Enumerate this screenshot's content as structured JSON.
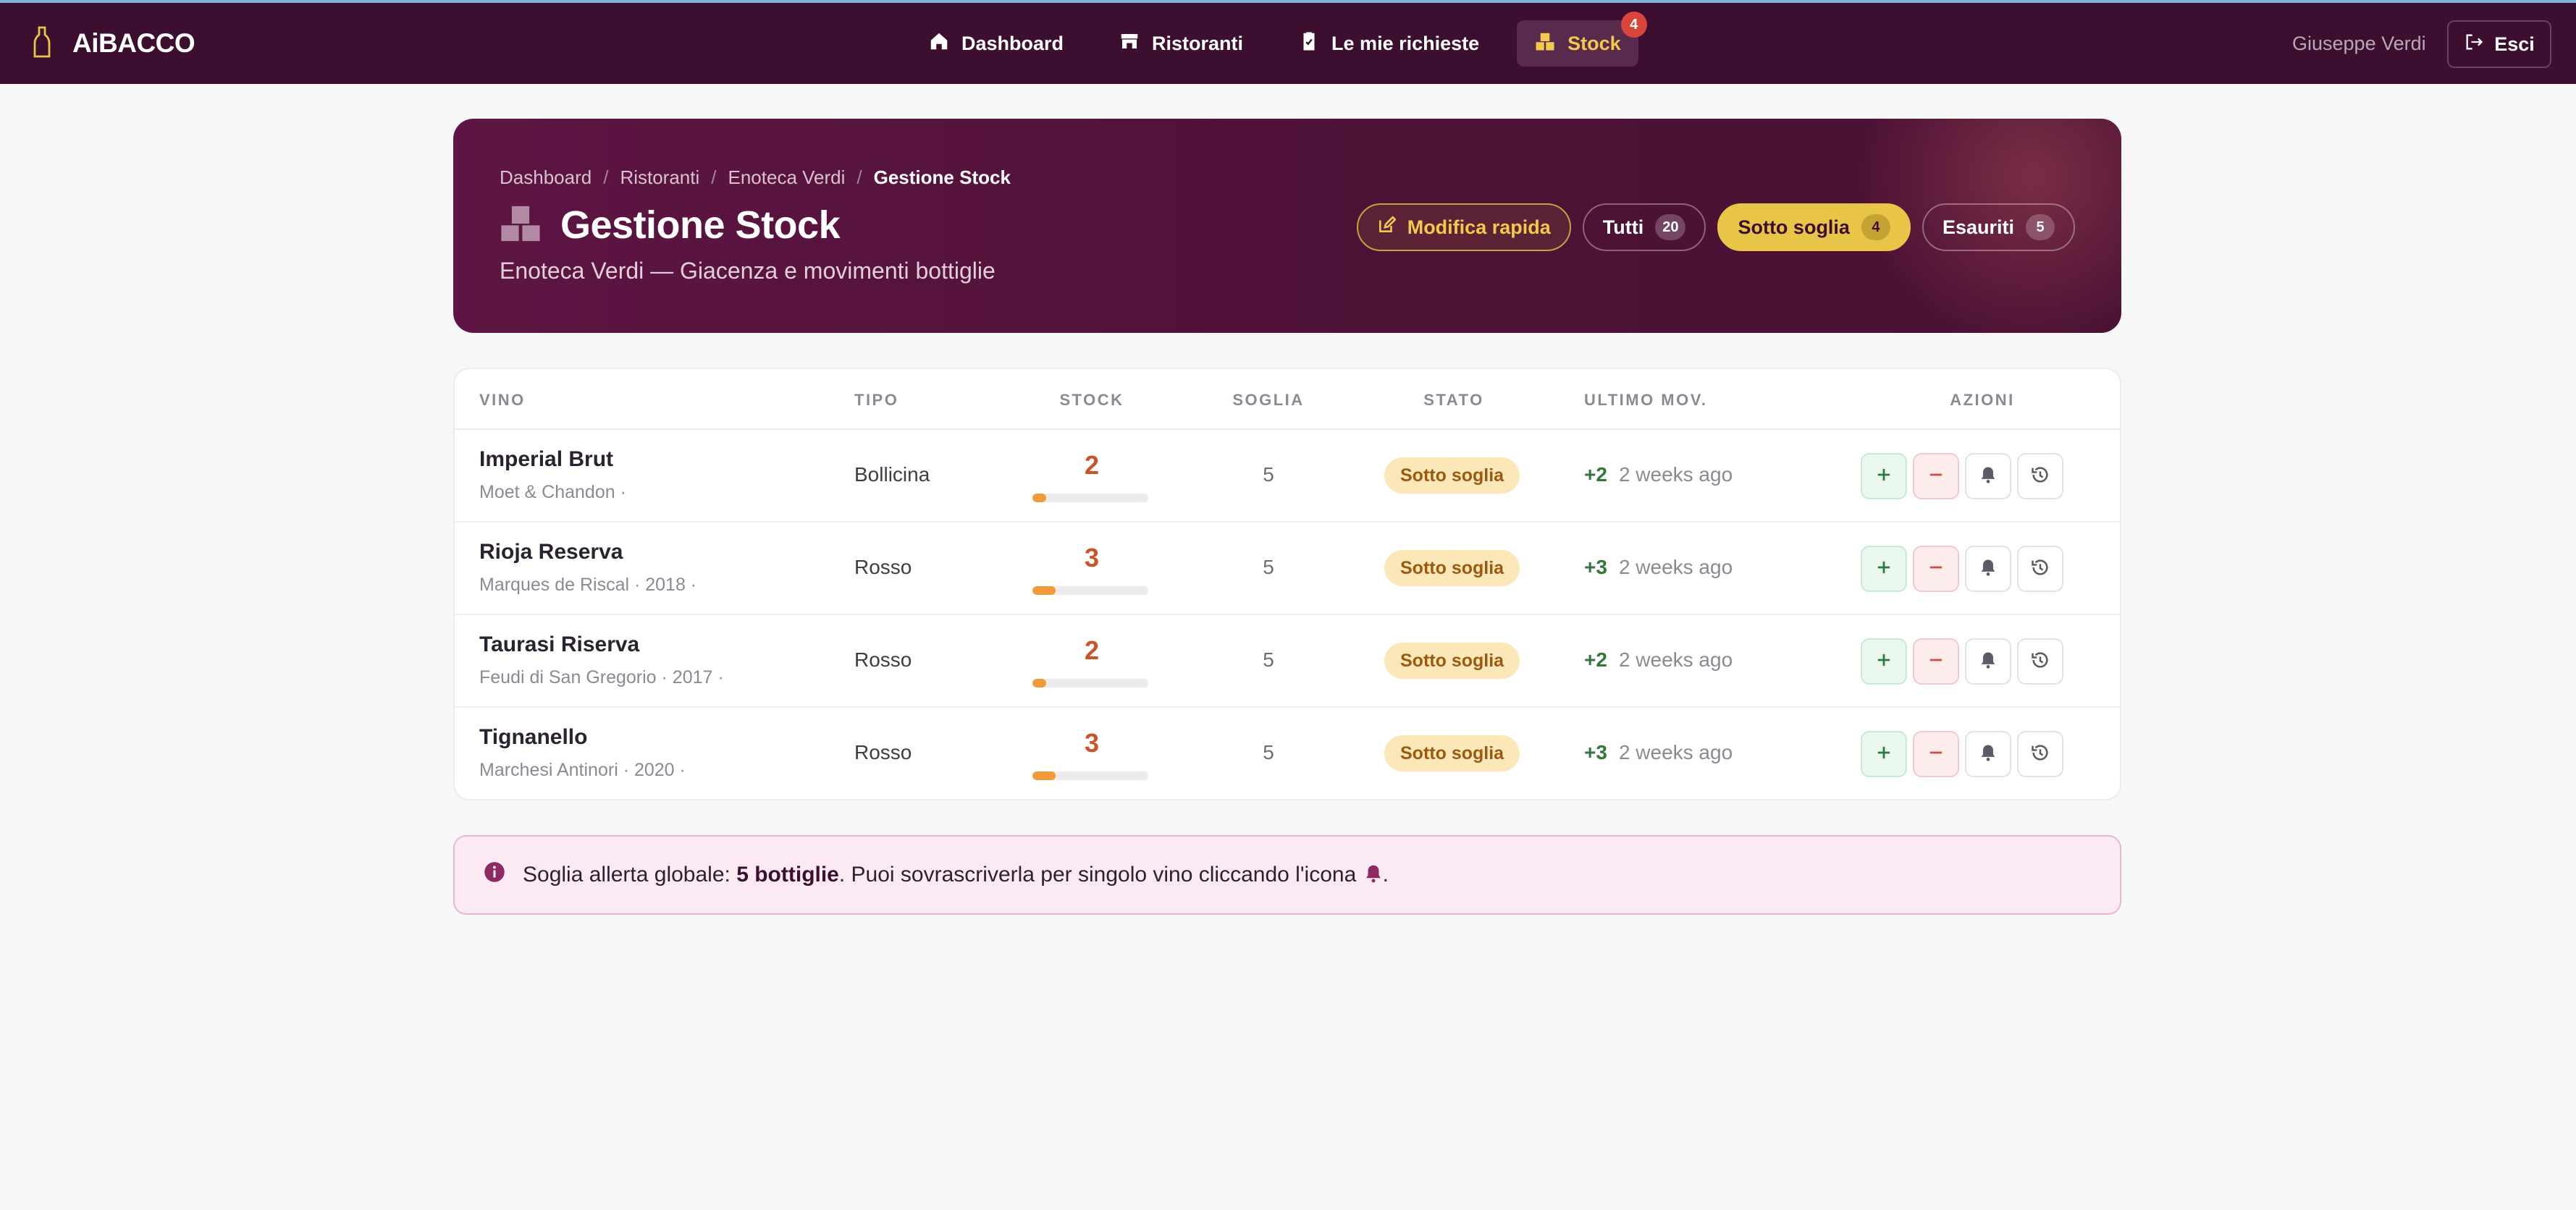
{
  "brand": {
    "name": "AiBACCO"
  },
  "nav": {
    "items": [
      {
        "label": "Dashboard",
        "icon": "home-icon"
      },
      {
        "label": "Ristoranti",
        "icon": "store-icon"
      },
      {
        "label": "Le mie richieste",
        "icon": "clipboard-check-icon"
      },
      {
        "label": "Stock",
        "icon": "boxes-icon",
        "badge": "4",
        "active": true
      }
    ]
  },
  "user": {
    "name": "Giuseppe Verdi",
    "logout_label": "Esci"
  },
  "hero": {
    "breadcrumb": [
      "Dashboard",
      "Ristoranti",
      "Enoteca Verdi",
      "Gestione Stock"
    ],
    "title": "Gestione Stock",
    "subtitle": "Enoteca Verdi — Giacenza e movimenti bottiglie",
    "quick_edit_label": "Modifica rapida",
    "filters": [
      {
        "label": "Tutti",
        "count": "20"
      },
      {
        "label": "Sotto soglia",
        "count": "4",
        "active": true
      },
      {
        "label": "Esauriti",
        "count": "5"
      }
    ]
  },
  "table": {
    "headers": {
      "vino": "VINO",
      "tipo": "TIPO",
      "stock": "STOCK",
      "soglia": "SOGLIA",
      "stato": "STATO",
      "ultimo_mov": "ULTIMO MOV.",
      "azioni": "AZIONI"
    },
    "rows": [
      {
        "name": "Imperial Brut",
        "meta": "Moet & Chandon ·",
        "tipo": "Bollicina",
        "stock": "2",
        "stock_fill": 0.12,
        "soglia": "5",
        "stato": "Sotto soglia",
        "delta": "+2",
        "when": "2 weeks ago"
      },
      {
        "name": "Rioja Reserva",
        "meta": "Marques de Riscal · 2018 ·",
        "tipo": "Rosso",
        "stock": "3",
        "stock_fill": 0.2,
        "soglia": "5",
        "stato": "Sotto soglia",
        "delta": "+3",
        "when": "2 weeks ago"
      },
      {
        "name": "Taurasi Riserva",
        "meta": "Feudi di San Gregorio · 2017 ·",
        "tipo": "Rosso",
        "stock": "2",
        "stock_fill": 0.12,
        "soglia": "5",
        "stato": "Sotto soglia",
        "delta": "+2",
        "when": "2 weeks ago"
      },
      {
        "name": "Tignanello",
        "meta": "Marchesi Antinori · 2020 ·",
        "tipo": "Rosso",
        "stock": "3",
        "stock_fill": 0.2,
        "soglia": "5",
        "stato": "Sotto soglia",
        "delta": "+3",
        "when": "2 weeks ago"
      }
    ]
  },
  "info": {
    "prefix": "Soglia allerta globale: ",
    "bold": "5 bottiglie",
    "suffix": ". Puoi sovrascriverla per singolo vino cliccando l'icona",
    "end": "."
  },
  "colors": {
    "navbar": "#3c0f30",
    "accent": "#e8c547",
    "stock_low": "#c9542b",
    "badge_bg": "#fbe7b8"
  }
}
